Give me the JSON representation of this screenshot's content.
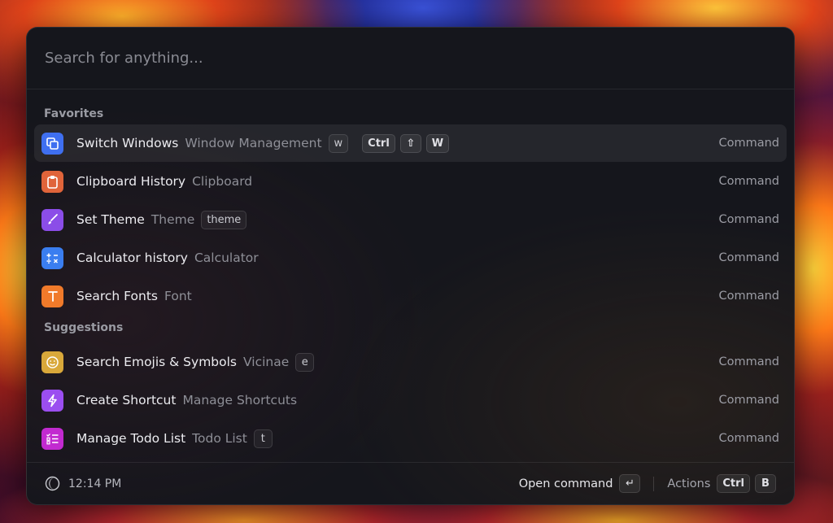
{
  "search": {
    "placeholder": "Search for anything..."
  },
  "sections": [
    {
      "title": "Favorites",
      "items": [
        {
          "title": "Switch Windows",
          "subtitle": "Window Management",
          "alias": "w",
          "hotkeys": [
            "Ctrl",
            "⇧",
            "W"
          ],
          "type": "Command",
          "icon": "windows-stack-icon",
          "icon_color": "#3f6ff0",
          "selected": true
        },
        {
          "title": "Clipboard History",
          "subtitle": "Clipboard",
          "type": "Command",
          "icon": "clipboard-icon",
          "icon_color": "#e0643a"
        },
        {
          "title": "Set Theme",
          "subtitle": "Theme",
          "alias": "theme",
          "type": "Command",
          "icon": "brush-icon",
          "icon_color": "#8b4de8"
        },
        {
          "title": "Calculator history",
          "subtitle": "Calculator",
          "type": "Command",
          "icon": "calculator-icon",
          "icon_color": "#3a7ef0"
        },
        {
          "title": "Search Fonts",
          "subtitle": "Font",
          "type": "Command",
          "icon": "font-icon",
          "icon_color": "#f07a2a"
        }
      ]
    },
    {
      "title": "Suggestions",
      "items": [
        {
          "title": "Search Emojis & Symbols",
          "subtitle": "Vicinae",
          "alias": "e",
          "type": "Command",
          "icon": "smiley-icon",
          "icon_color": "#d9a83a"
        },
        {
          "title": "Create Shortcut",
          "subtitle": "Manage Shortcuts",
          "type": "Command",
          "icon": "bolt-icon",
          "icon_color": "#9b4ef0"
        },
        {
          "title": "Manage Todo List",
          "subtitle": "Todo List",
          "alias": "t",
          "type": "Command",
          "icon": "checklist-icon",
          "icon_color": "#c22ad0"
        }
      ]
    }
  ],
  "footer": {
    "time": "12:14 PM",
    "primary_action": "Open command",
    "primary_key": "↵",
    "actions_label": "Actions",
    "actions_keys": [
      "Ctrl",
      "B"
    ]
  }
}
